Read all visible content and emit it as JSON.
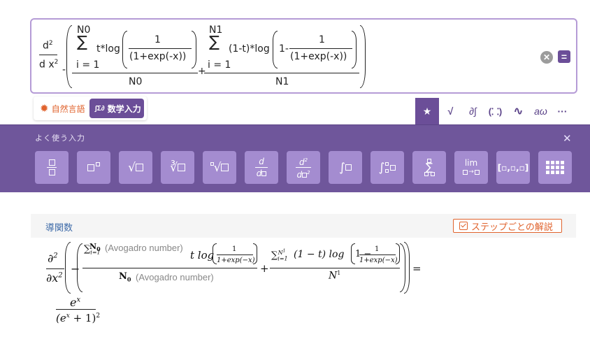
{
  "input": {
    "d_num": "d",
    "d_num_sup": "2",
    "d_den": "d x",
    "d_den_sup": "2",
    "minus": "-",
    "plus": "+",
    "sum1_upper": "N0",
    "sum1_lower": "i = 1",
    "term1_prefix": "t*log",
    "frac_num": "1",
    "frac_den": "(1+exp(-x))",
    "den1": "N0",
    "sum2_upper": "N1",
    "sum2_lower": "i = 1",
    "term2_prefix": "(1-t)*log",
    "term2_one": "1-",
    "den2": "N1",
    "sigma": "∑"
  },
  "buttons": {
    "clear": "✕",
    "equals": "="
  },
  "modes": {
    "natural": "自然言語",
    "math": "数学入力",
    "math_icon": "∫Σ∂"
  },
  "tabs": [
    "★",
    "√",
    "∂∫",
    "(⸬)",
    "∿",
    "aω",
    "···"
  ],
  "keypad": {
    "title": "よく使う入力",
    "close": "✕",
    "keys": [
      {
        "name": "fraction-key"
      },
      {
        "name": "power-key"
      },
      {
        "name": "sqrt-key",
        "label": "√"
      },
      {
        "name": "cbrt-key",
        "label": "∛"
      },
      {
        "name": "nth-root-key",
        "label": "√"
      },
      {
        "name": "derivative-key",
        "top": "d",
        "bottom": "d"
      },
      {
        "name": "second-derivative-key",
        "top": "d",
        "sup": "2",
        "bottom": "d"
      },
      {
        "name": "integral-key",
        "label": "∫"
      },
      {
        "name": "definite-integral-key",
        "label": "∫"
      },
      {
        "name": "sum-key",
        "label": "∑"
      },
      {
        "name": "limit-key",
        "label": "lim",
        "arrow": "→"
      },
      {
        "name": "vector-key",
        "label": "[▫,▫,▫]"
      },
      {
        "name": "matrix-key"
      }
    ]
  },
  "result": {
    "title": "導関数",
    "steps_label": "ステップごとの解説",
    "partial_num": "∂",
    "partial_num_sup": "2",
    "partial_den": "∂x",
    "partial_den_sup": "2",
    "minus": "−",
    "plus": "+",
    "equals": "=",
    "sum1": "∑",
    "sum1_sub": "i=1",
    "sum1_sup": "N",
    "sum1_sup_sub": "0",
    "note1": "(Avogadro number)",
    "term1": "t log",
    "frac_num": "1",
    "frac_den": "1+exp(−x)",
    "den1": "N",
    "den1_sub": "0",
    "note2": "(Avogadro number)",
    "sum2": "∑",
    "sum2_sub": "i=1",
    "sum2_sup": "N",
    "sum2_sup2": "1",
    "term2": "(1 − t) log",
    "term2_one": "1 −",
    "den2": "N",
    "den2_sup": "1",
    "ans_num": "e",
    "ans_num_sup": "x",
    "ans_den": "(e",
    "ans_den_sup": "x",
    "ans_den_rest": " + 1)",
    "ans_den_sup2": "2"
  },
  "colors": {
    "accent": "#6b4e98",
    "keypad_bg": "#6f569b",
    "key_bg": "#a48cd0",
    "orange": "#e0632d",
    "link_blue": "#3d6aa8"
  }
}
